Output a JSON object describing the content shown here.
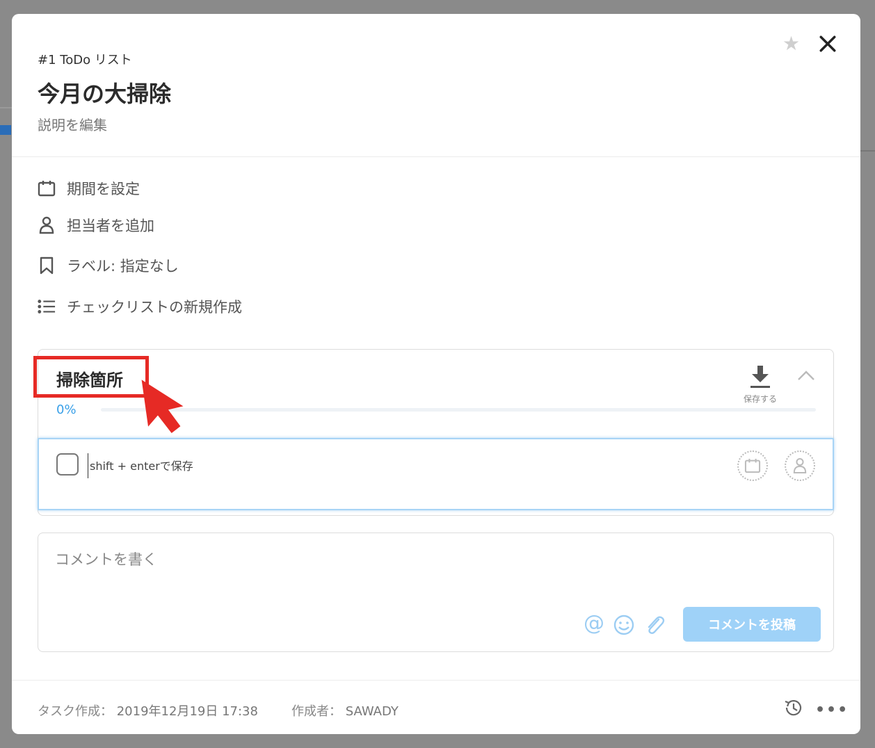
{
  "task": {
    "id_label": "#1 ToDo リスト",
    "title": "今月の大掃除",
    "edit_description": "説明を編集"
  },
  "properties": {
    "due": "期間を設定",
    "assignee": "担当者を追加",
    "label": "ラベル: 指定なし",
    "new_checklist": "チェックリストの新規作成"
  },
  "checklist": {
    "title": "掃除箇所",
    "save_label": "保存する",
    "progress_text": "0%",
    "progress": 0,
    "item_placeholder": "shift + enterで保存"
  },
  "comment": {
    "placeholder": "コメントを書く",
    "post_label": "コメントを投稿"
  },
  "footer": {
    "created_label": "タスク作成：",
    "created_value": "2019年12月19日 17:38",
    "author_label": "作成者：",
    "author_value": "SAWADY"
  },
  "icons": {
    "star": "star-icon",
    "close": "close-icon",
    "calendar": "calendar-icon",
    "person": "person-icon",
    "bookmark": "bookmark-icon",
    "list": "list-icon",
    "download": "download-icon",
    "chevron": "chevron-up-icon",
    "at": "at-icon",
    "emoji": "emoji-icon",
    "attach": "paperclip-icon",
    "history": "history-icon",
    "more": "more-icon"
  },
  "colors": {
    "accent": "#3aa0e8",
    "post_button": "#9fd2f8",
    "highlight": "#e62a25"
  }
}
